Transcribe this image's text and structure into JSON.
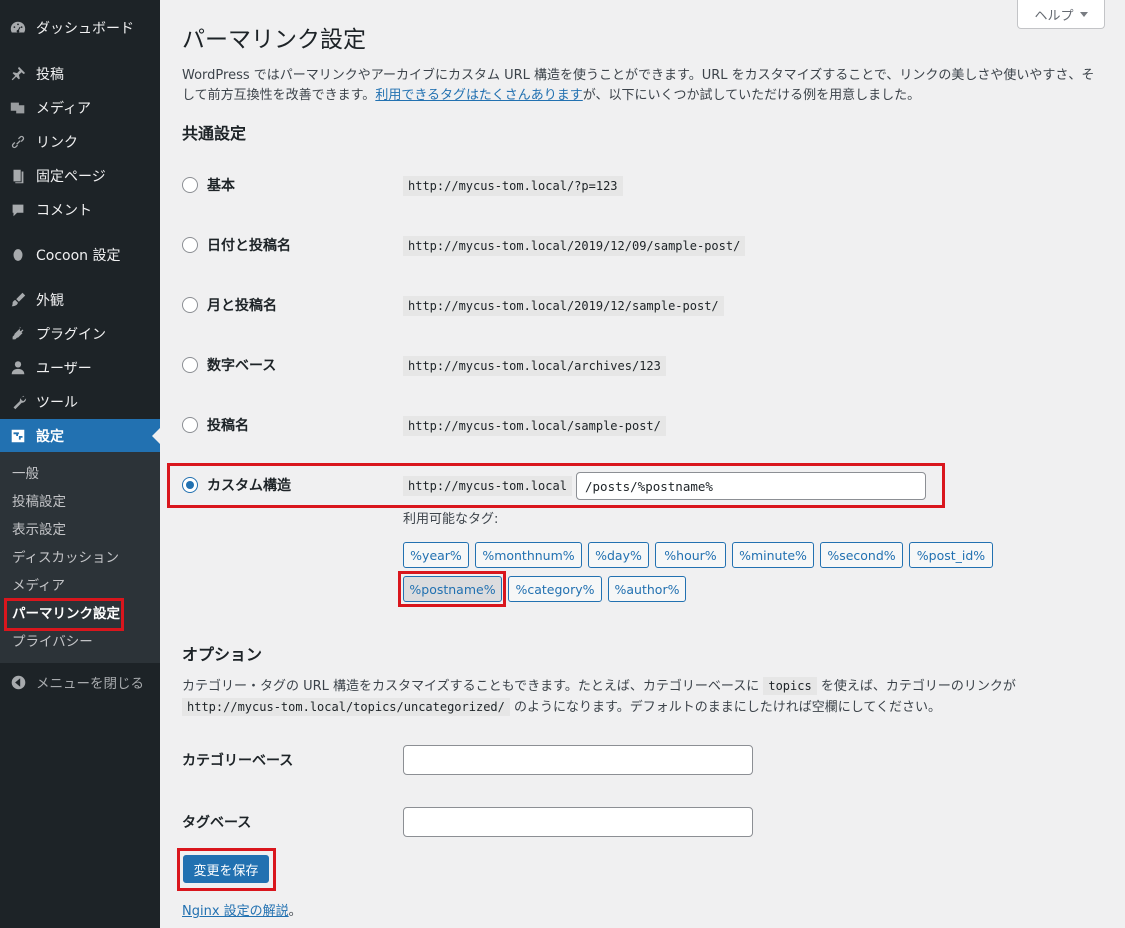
{
  "sidebar": {
    "items": [
      {
        "label": "ダッシュボード",
        "icon": "dashboard-icon"
      },
      {
        "label": "投稿",
        "icon": "pin-icon"
      },
      {
        "label": "メディア",
        "icon": "media-icon"
      },
      {
        "label": "リンク",
        "icon": "link-icon"
      },
      {
        "label": "固定ページ",
        "icon": "page-icon"
      },
      {
        "label": "コメント",
        "icon": "comment-icon"
      },
      {
        "label": "Cocoon 設定",
        "icon": "cocoon-icon"
      },
      {
        "label": "外観",
        "icon": "brush-icon"
      },
      {
        "label": "プラグイン",
        "icon": "plugin-icon"
      },
      {
        "label": "ユーザー",
        "icon": "user-icon"
      },
      {
        "label": "ツール",
        "icon": "wrench-icon"
      },
      {
        "label": "設定",
        "icon": "settings-icon"
      }
    ],
    "submenu": [
      "一般",
      "投稿設定",
      "表示設定",
      "ディスカッション",
      "メディア",
      "パーマリンク設定",
      "プライバシー"
    ],
    "collapse_label": "メニューを閉じる"
  },
  "header": {
    "help_label": "ヘルプ",
    "title": "パーマリンク設定"
  },
  "intro": {
    "text_before": "WordPress ではパーマリンクやアーカイブにカスタム URL 構造を使うことができます。URL をカスタマイズすることで、リンクの美しさや使いやすさ、そして前方互換性を改善できます。",
    "link": "利用できるタグはたくさんあります",
    "text_after": "が、以下にいくつか試していただける例を用意しました。"
  },
  "common": {
    "heading": "共通設定",
    "options": [
      {
        "label": "基本",
        "sample": "http://mycus-tom.local/?p=123"
      },
      {
        "label": "日付と投稿名",
        "sample": "http://mycus-tom.local/2019/12/09/sample-post/"
      },
      {
        "label": "月と投稿名",
        "sample": "http://mycus-tom.local/2019/12/sample-post/"
      },
      {
        "label": "数字ベース",
        "sample": "http://mycus-tom.local/archives/123"
      },
      {
        "label": "投稿名",
        "sample": "http://mycus-tom.local/sample-post/"
      }
    ],
    "custom": {
      "label": "カスタム構造",
      "prefix": "http://mycus-tom.local",
      "value": "/posts/%postname%"
    },
    "tags_label": "利用可能なタグ:",
    "tags": [
      "%year%",
      "%monthnum%",
      "%day%",
      "%hour%",
      "%minute%",
      "%second%",
      "%post_id%",
      "%postname%",
      "%category%",
      "%author%"
    ]
  },
  "options": {
    "heading": "オプション",
    "desc_1": "カテゴリー・タグの URL 構造をカスタマイズすることもできます。たとえば、カテゴリーベースに",
    "desc_code_1": "topics",
    "desc_2": "を使えば、カテゴリーのリンクが",
    "desc_code_2": "http://mycus-tom.local/topics/uncategorized/",
    "desc_3": "のようになります。デフォルトのままにしたければ空欄にしてください。",
    "category_base_label": "カテゴリーベース",
    "category_base_value": "",
    "tag_base_label": "タグベース",
    "tag_base_value": ""
  },
  "footer": {
    "save_label": "変更を保存",
    "nginx_link": "Nginx 設定の解説",
    "nginx_suffix": "。"
  },
  "colors": {
    "sidebar_bg": "#1d2327",
    "accent": "#2271b1",
    "highlight_box": "#d9161d"
  }
}
